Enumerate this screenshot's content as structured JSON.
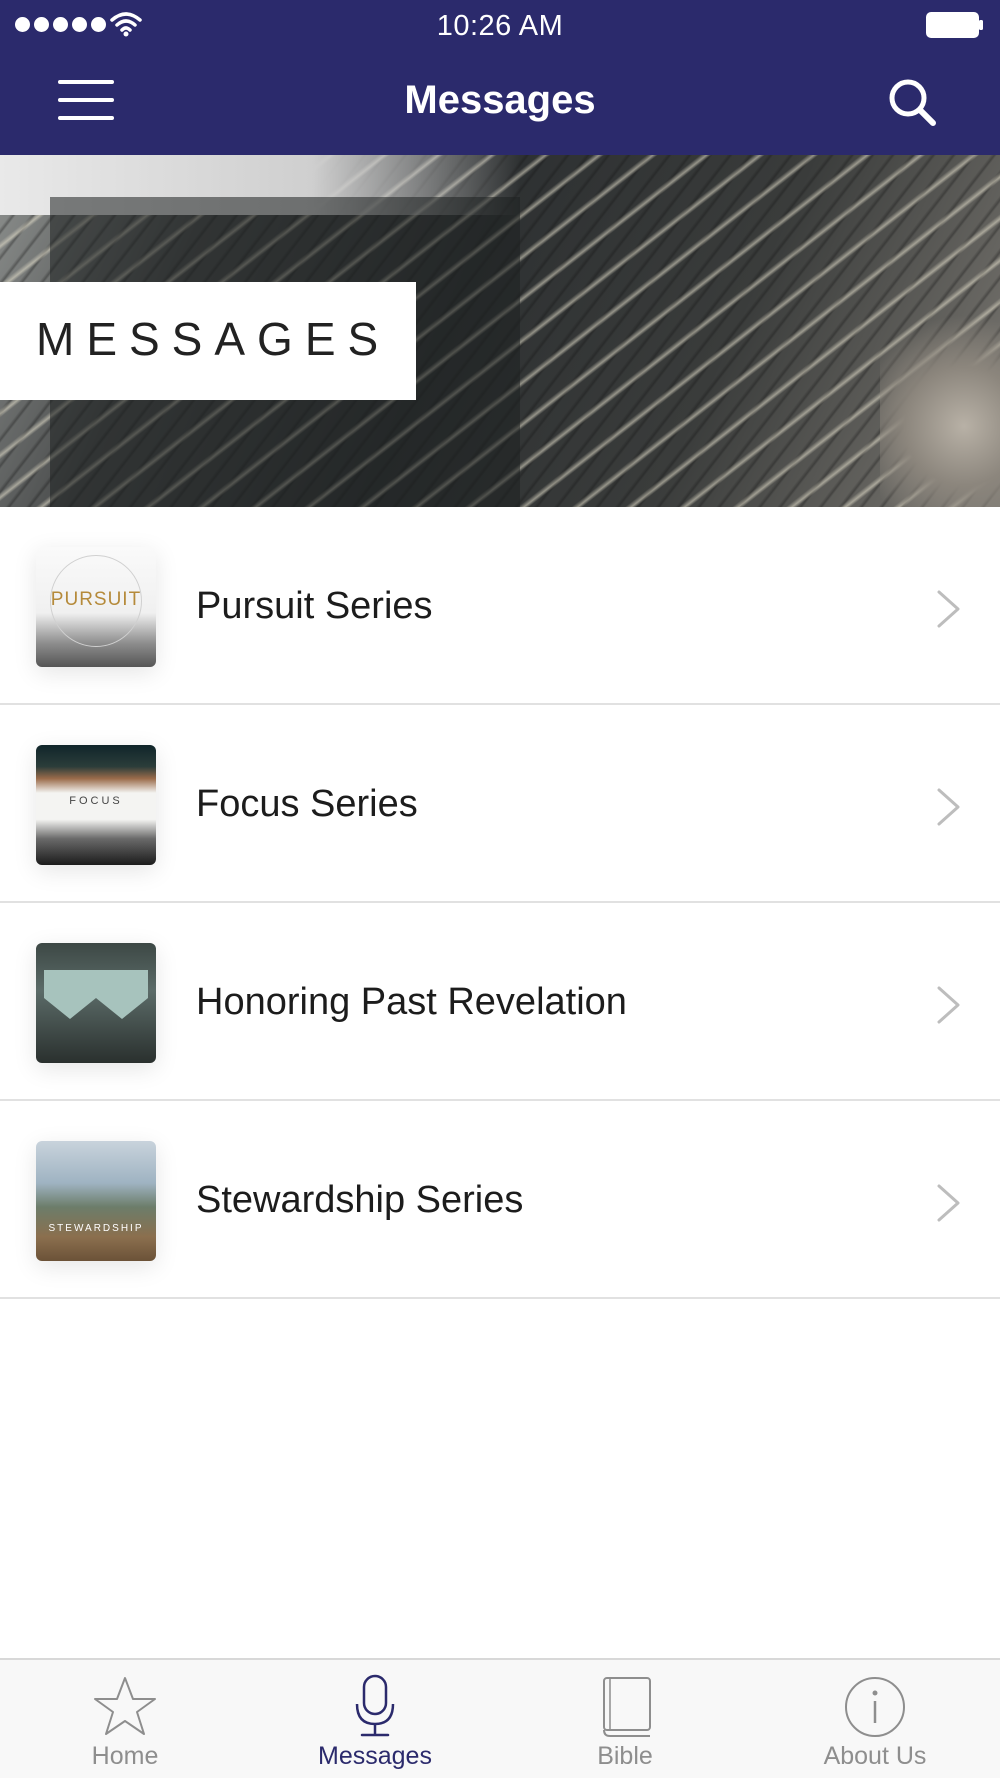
{
  "colors": {
    "nav_background": "#2b2a6c",
    "active_tab": "#2b2a6c",
    "inactive_tab": "#8e8e8e"
  },
  "status_bar": {
    "time": "10:26 AM",
    "signal_icon": "signal-dots-icon",
    "wifi_icon": "wifi-icon",
    "battery_icon": "battery-icon"
  },
  "nav": {
    "title": "Messages",
    "menu_icon": "hamburger-menu-icon",
    "search_icon": "search-icon"
  },
  "banner": {
    "label": "MESSAGES"
  },
  "series": [
    {
      "label": "Pursuit Series",
      "thumb_text": "PURSUIT"
    },
    {
      "label": "Focus Series",
      "thumb_text": "FOCUS"
    },
    {
      "label": "Honoring Past Revelation",
      "thumb_text": ""
    },
    {
      "label": "Stewardship Series",
      "thumb_text": "STEWARDSHIP"
    }
  ],
  "tabs": [
    {
      "label": "Home",
      "icon": "star-icon",
      "active": false
    },
    {
      "label": "Messages",
      "icon": "microphone-icon",
      "active": true
    },
    {
      "label": "Bible",
      "icon": "book-icon",
      "active": false
    },
    {
      "label": "About Us",
      "icon": "info-icon",
      "active": false
    }
  ]
}
